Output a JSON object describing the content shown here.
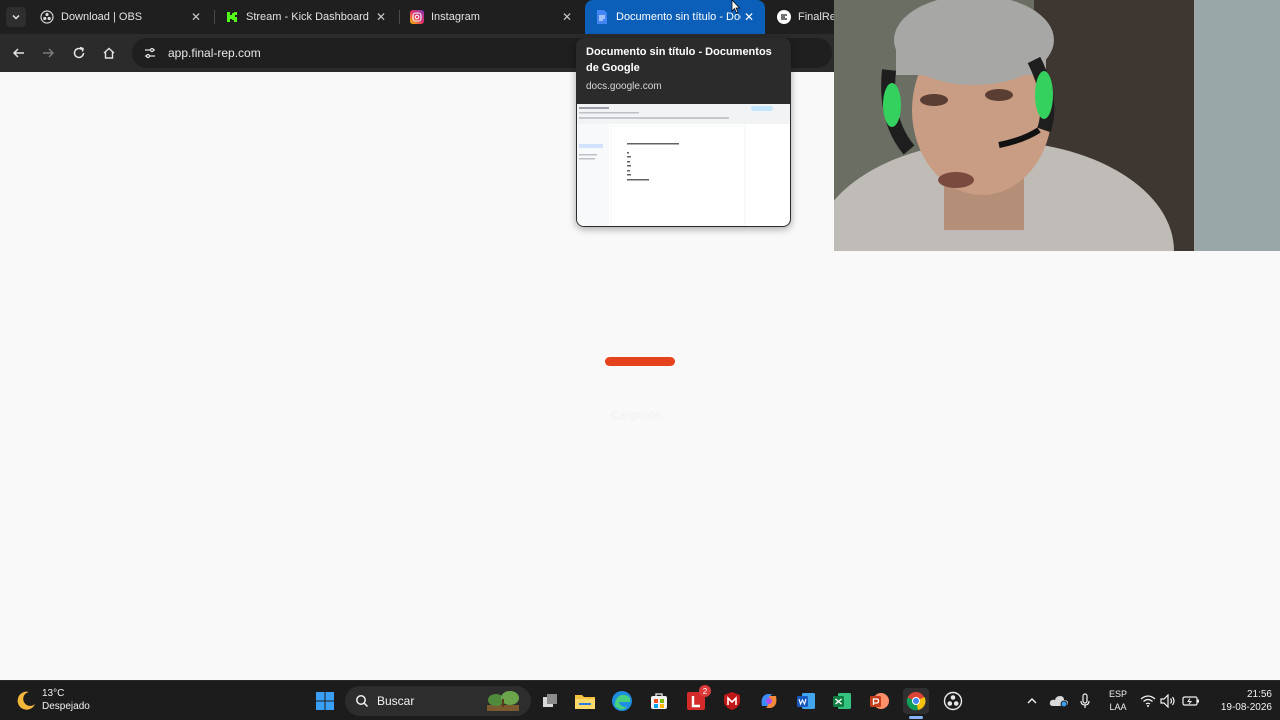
{
  "browser": {
    "tabs": [
      {
        "label": "Download | OBS",
        "icon": "obs-icon"
      },
      {
        "label": "Stream - Kick Dashboard",
        "icon": "kick-icon"
      },
      {
        "label": "Instagram",
        "icon": "instagram-icon"
      },
      {
        "label": "Documento sin título - Docu",
        "icon": "docs-icon",
        "active": true
      },
      {
        "label": "FinalRep",
        "icon": "finalrep-icon"
      }
    ],
    "address": {
      "url": "app.final-rep.com"
    },
    "hover_card": {
      "title": "Documento sin título - Documentos de Google",
      "domain": "docs.google.com"
    },
    "accent_color": "#0c5fb8"
  },
  "page": {
    "loader_color": "#e5431b",
    "loader_text": "Cargando..."
  },
  "taskbar": {
    "weather": {
      "temp": "13°C",
      "desc": "Despejado"
    },
    "search_label": "Buscar",
    "apps": [
      "windows-start-icon",
      "search-icon",
      "widgets-icon",
      "task-view-icon",
      "file-explorer-icon",
      "edge-icon",
      "store-icon",
      "l-app-icon",
      "mcafee-icon",
      "copilot-icon",
      "word-icon",
      "excel-icon",
      "powerpoint-icon",
      "chrome-icon",
      "obs-icon"
    ],
    "badge_count": "2",
    "lang": {
      "line1": "ESP",
      "line2": "LAA"
    },
    "clock": {
      "time": "21:56",
      "date": "19-08-2026"
    }
  }
}
